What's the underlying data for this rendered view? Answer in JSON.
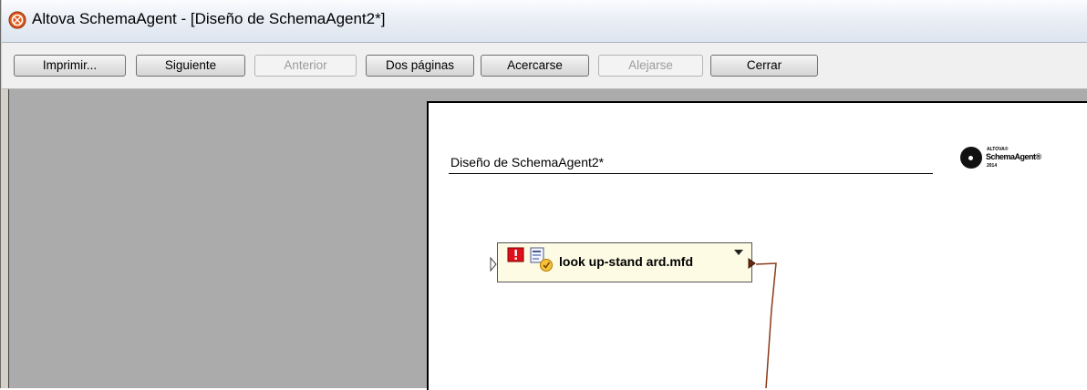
{
  "window": {
    "title": "Altova SchemaAgent - [Diseño de SchemaAgent2*]",
    "icon": "altova-icon"
  },
  "toolbar": {
    "buttons": [
      {
        "label": "Imprimir...",
        "enabled": true
      },
      {
        "label": "Siguiente",
        "enabled": true
      },
      {
        "label": "Anterior",
        "enabled": false
      },
      {
        "label": "Dos páginas",
        "enabled": true
      },
      {
        "label": "Acercarse",
        "enabled": true
      },
      {
        "label": "Alejarse",
        "enabled": false
      },
      {
        "label": "Cerrar",
        "enabled": true
      }
    ]
  },
  "page": {
    "title": "Diseño de SchemaAgent2*",
    "logo": {
      "small_text": "ALTOVA®",
      "name": "SchemaAgent®",
      "year": "2014"
    },
    "component": {
      "label": "look up-stand ard.mfd",
      "icons": [
        "error-icon",
        "mapforce-file-icon",
        "dropdown-arrow-icon"
      ]
    }
  },
  "colors": {
    "connector": "#8b3a1a",
    "component_bg": "#fdfbe4",
    "workspace_bg": "#ababab"
  }
}
